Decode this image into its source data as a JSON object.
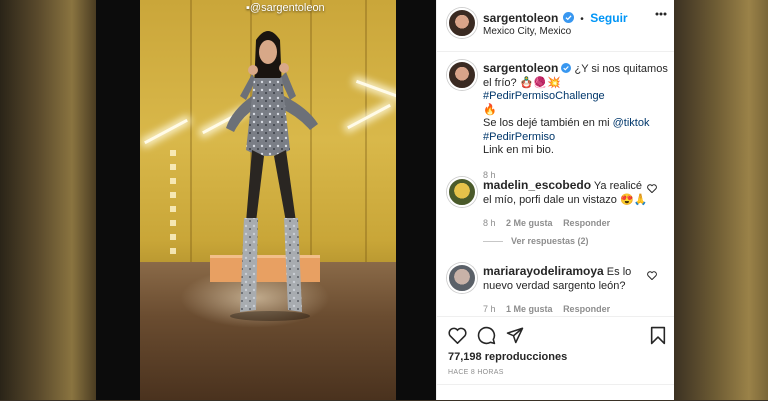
{
  "post": {
    "username": "sargentoleon",
    "follow_label": "Seguir",
    "separator": "•",
    "location": "Mexico City, Mexico",
    "watermark": "@sargentoleon"
  },
  "caption": {
    "username": "sargentoleon",
    "text_part1": "¿Y si nos quitamos el frío? 🪆🧶💥",
    "hashtag1": "#PedirPermisoChallenge",
    "emoji": "🔥",
    "text_part2": "Se los dejé también en mi",
    "mention": "@tiktok",
    "hashtag2": "#PedirPermiso",
    "text_part3": "Link en mi bio.",
    "time": "8 h"
  },
  "comments": [
    {
      "username": "madelin_escobedo",
      "text": "Ya realicé el mío, porfi dale un vistazo 😍🙏",
      "time": "8 h",
      "likes": "2 Me gusta",
      "reply": "Responder"
    },
    {
      "username": "mariarayodeliramoya",
      "text": "Es lo nuevo verdad sargento león?",
      "time": "7 h",
      "likes": "1 Me gusta",
      "reply": "Responder"
    }
  ],
  "view_replies": "Ver respuestas (2)",
  "stats": {
    "views": "77,198 reproducciones",
    "posted": "HACE 8 HORAS"
  },
  "icons": [
    "verified-badge-icon",
    "more-options-icon",
    "heart-icon",
    "comment-icon",
    "share-icon",
    "bookmark-icon",
    "expand-icon"
  ],
  "colors": {
    "accent": "#0095f6",
    "muted": "#8e8e8e",
    "text": "#262626"
  }
}
